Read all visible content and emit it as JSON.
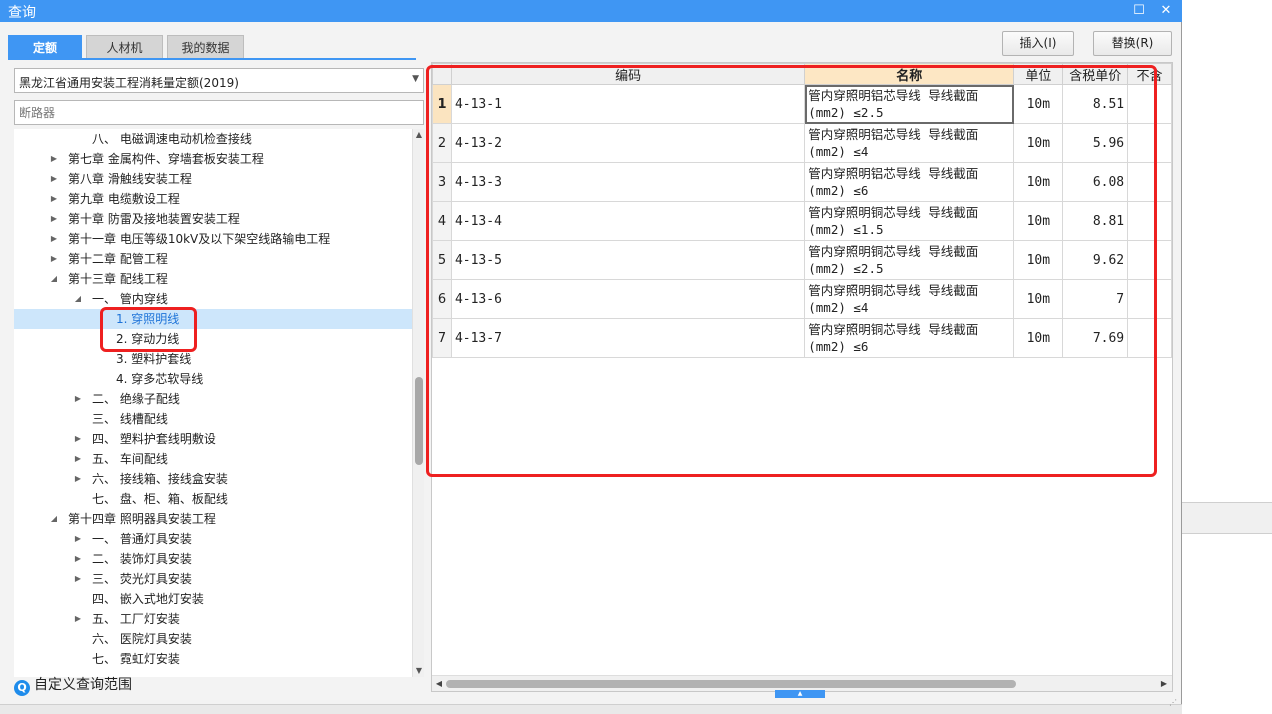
{
  "window": {
    "title": "查询"
  },
  "tabs": [
    {
      "label": "定额",
      "active": true
    },
    {
      "label": "人材机",
      "active": false
    },
    {
      "label": "我的数据",
      "active": false
    }
  ],
  "actions": {
    "insert": "插入(I)",
    "replace": "替换(R)"
  },
  "left": {
    "library": "黑龙江省通用安装工程消耗量定额(2019)",
    "filter_placeholder": "断路器",
    "tree": [
      {
        "label": "八、 电磁调速电动机检查接线",
        "level": 2,
        "toggle": "",
        "selected": false
      },
      {
        "label": "第七章 金属构件、穿墙套板安装工程",
        "level": 1,
        "toggle": "▶",
        "selected": false
      },
      {
        "label": "第八章 滑触线安装工程",
        "level": 1,
        "toggle": "▶",
        "selected": false
      },
      {
        "label": "第九章 电缆敷设工程",
        "level": 1,
        "toggle": "▶",
        "selected": false
      },
      {
        "label": "第十章 防雷及接地装置安装工程",
        "level": 1,
        "toggle": "▶",
        "selected": false
      },
      {
        "label": "第十一章 电压等级10kV及以下架空线路输电工程",
        "level": 1,
        "toggle": "▶",
        "selected": false
      },
      {
        "label": "第十二章 配管工程",
        "level": 1,
        "toggle": "▶",
        "selected": false
      },
      {
        "label": "第十三章 配线工程",
        "level": 1,
        "toggle": "◢",
        "selected": false
      },
      {
        "label": "一、 管内穿线",
        "level": 2,
        "toggle": "◢",
        "selected": false
      },
      {
        "label": "1. 穿照明线",
        "level": 3,
        "toggle": "",
        "selected": true
      },
      {
        "label": "2. 穿动力线",
        "level": 3,
        "toggle": "",
        "selected": false
      },
      {
        "label": "3. 塑料护套线",
        "level": 3,
        "toggle": "",
        "selected": false
      },
      {
        "label": "4. 穿多芯软导线",
        "level": 3,
        "toggle": "",
        "selected": false
      },
      {
        "label": "二、 绝缘子配线",
        "level": 2,
        "toggle": "▶",
        "selected": false
      },
      {
        "label": "三、 线槽配线",
        "level": 2,
        "toggle": "",
        "selected": false
      },
      {
        "label": "四、 塑料护套线明敷设",
        "level": 2,
        "toggle": "▶",
        "selected": false
      },
      {
        "label": "五、 车间配线",
        "level": 2,
        "toggle": "▶",
        "selected": false
      },
      {
        "label": "六、 接线箱、接线盒安装",
        "level": 2,
        "toggle": "▶",
        "selected": false
      },
      {
        "label": "七、 盘、柜、箱、板配线",
        "level": 2,
        "toggle": "",
        "selected": false
      },
      {
        "label": "第十四章 照明器具安装工程",
        "level": 1,
        "toggle": "◢",
        "selected": false
      },
      {
        "label": "一、 普通灯具安装",
        "level": 2,
        "toggle": "▶",
        "selected": false
      },
      {
        "label": "二、 装饰灯具安装",
        "level": 2,
        "toggle": "▶",
        "selected": false
      },
      {
        "label": "三、 荧光灯具安装",
        "level": 2,
        "toggle": "▶",
        "selected": false
      },
      {
        "label": "四、 嵌入式地灯安装",
        "level": 2,
        "toggle": "",
        "selected": false
      },
      {
        "label": "五、 工厂灯安装",
        "level": 2,
        "toggle": "▶",
        "selected": false
      },
      {
        "label": "六、 医院灯具安装",
        "level": 2,
        "toggle": "",
        "selected": false
      },
      {
        "label": "七、 霓虹灯安装",
        "level": 2,
        "toggle": "",
        "selected": false
      }
    ],
    "custom_scope": "自定义查询范围"
  },
  "grid": {
    "columns": [
      "编码",
      "名称",
      "单位",
      "含税单价",
      "不含"
    ],
    "rows": [
      {
        "num": "1",
        "code": "4-13-1",
        "name1": "管内穿照明铝芯导线 导线截面",
        "name2": "(mm2) ≤2.5",
        "unit": "10m",
        "price": "8.51"
      },
      {
        "num": "2",
        "code": "4-13-2",
        "name1": "管内穿照明铝芯导线 导线截面",
        "name2": "(mm2) ≤4",
        "unit": "10m",
        "price": "5.96"
      },
      {
        "num": "3",
        "code": "4-13-3",
        "name1": "管内穿照明铝芯导线 导线截面",
        "name2": "(mm2) ≤6",
        "unit": "10m",
        "price": "6.08"
      },
      {
        "num": "4",
        "code": "4-13-4",
        "name1": "管内穿照明铜芯导线 导线截面",
        "name2": "(mm2) ≤1.5",
        "unit": "10m",
        "price": "8.81"
      },
      {
        "num": "5",
        "code": "4-13-5",
        "name1": "管内穿照明铜芯导线 导线截面",
        "name2": "(mm2) ≤2.5",
        "unit": "10m",
        "price": "9.62"
      },
      {
        "num": "6",
        "code": "4-13-6",
        "name1": "管内穿照明铜芯导线 导线截面",
        "name2": "(mm2) ≤4",
        "unit": "10m",
        "price": "7"
      },
      {
        "num": "7",
        "code": "4-13-7",
        "name1": "管内穿照明铜芯导线 导线截面",
        "name2": "(mm2) ≤6",
        "unit": "10m",
        "price": "7.69"
      }
    ]
  },
  "colors": {
    "accent": "#3f96f3",
    "highlight": "#ee2020",
    "selected_row": "#cde6fb"
  }
}
